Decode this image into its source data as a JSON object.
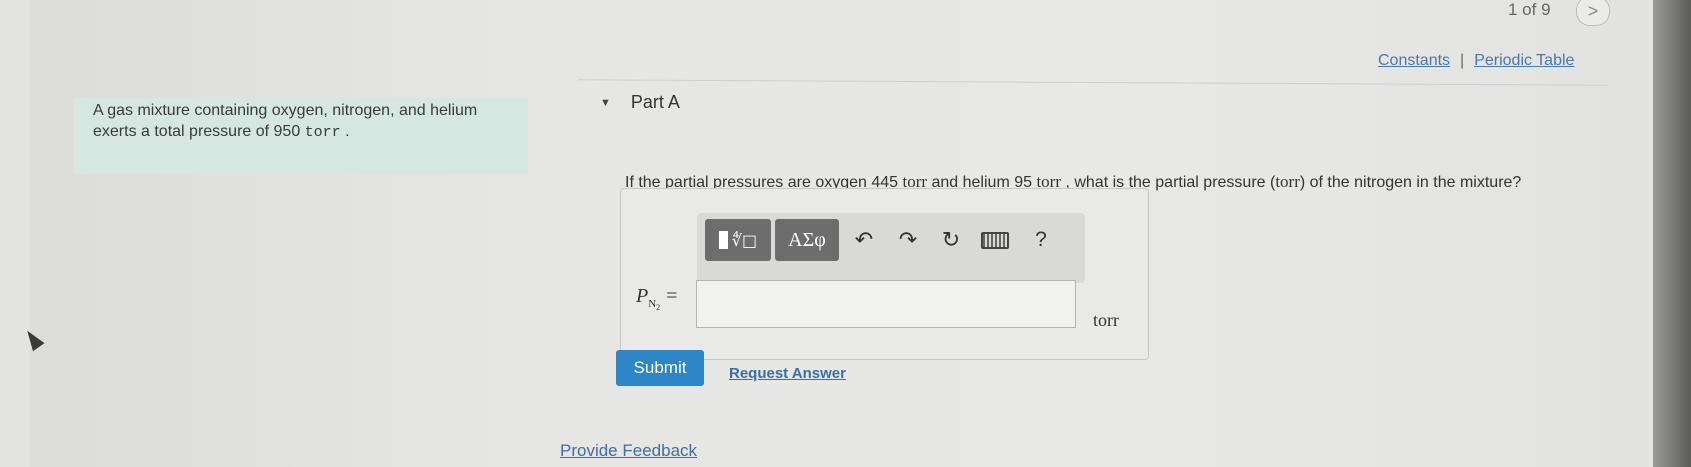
{
  "pager": {
    "text": "1 of 9",
    "next_icon": "chevron-right-icon",
    "next_label": ">"
  },
  "links": {
    "constants": "Constants",
    "separator": "|",
    "periodic_table": "Periodic Table"
  },
  "problem": {
    "text_before": "A gas mixture containing oxygen, nitrogen, and helium exerts a total pressure of 950 ",
    "unit": "torr",
    "text_after": " ."
  },
  "part": {
    "caret": "▼",
    "title": "Part A"
  },
  "question": {
    "t1": "If the partial pressures are oxygen 445 ",
    "u1": "torr",
    "t2": " and helium 95 ",
    "u2": "torr",
    "t3": " , what is the partial pressure (",
    "u3": "torr",
    "t4": ") of the nitrogen in the mixture?"
  },
  "toolbar": {
    "templates_label": "∜□",
    "greek_label": "ΑΣφ",
    "undo": "↶",
    "redo": "↷",
    "reset": "↻",
    "help": "?"
  },
  "answer": {
    "var": "P",
    "sub": "N",
    "sub2": "2",
    "eq": "=",
    "value": "",
    "unit": "torr"
  },
  "buttons": {
    "submit": "Submit",
    "request": "Request Answer"
  },
  "feedback": "Provide Feedback"
}
